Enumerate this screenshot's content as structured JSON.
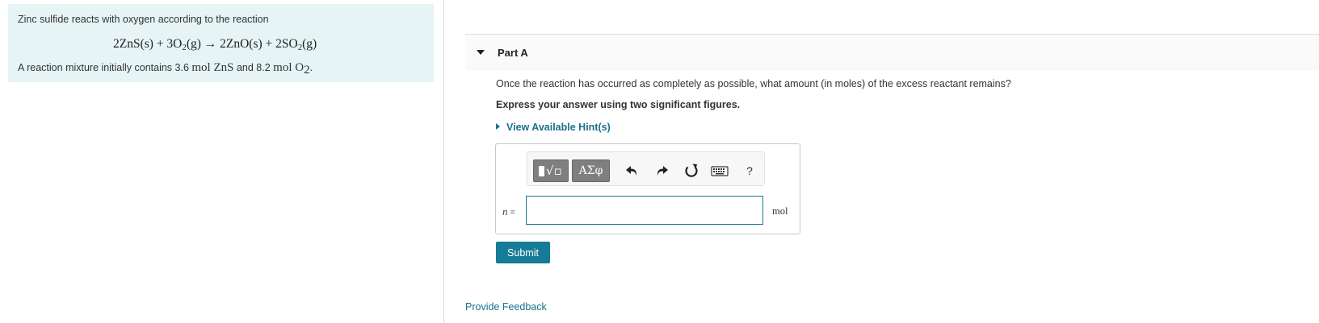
{
  "intro": {
    "statement": "Zinc sulfide reacts with oxygen according to the reaction",
    "equation": {
      "t1": "2ZnS(s) + 3O",
      "s1": "2",
      "t2": "(g) → 2ZnO(s) + 2SO",
      "s2": "2",
      "t3": "(g)"
    },
    "mixture": {
      "pre": "A reaction mixture initially contains ",
      "zns_amount": "3.6 ",
      "zns_unit": "mol ZnS",
      "mid": " and ",
      "o2_amount": "8.2 ",
      "o2_unit": "mol O",
      "o2_sub": "2",
      "end": "."
    }
  },
  "part": {
    "title": "Part A",
    "question": "Once the reaction has occurred as completely as possible, what amount (in moles) of the excess reactant remains?",
    "instruction": "Express your answer using two significant figures.",
    "hint_link": "View Available Hint(s)",
    "answer": {
      "variable": "n",
      "equals": " =",
      "value": "",
      "unit": "mol"
    },
    "toolbar": {
      "templates_icon": "radical-template-icon",
      "symbols_label": "ΑΣφ",
      "undo_icon": "undo-icon",
      "redo_icon": "redo-icon",
      "reset_icon": "reset-icon",
      "keyboard_icon": "keyboard-icon",
      "help_label": "?"
    },
    "submit_label": "Submit"
  },
  "feedback_link": "Provide Feedback",
  "colors": {
    "intro_bg": "#e6f4f5",
    "link": "#1a6f8f",
    "submit_bg": "#167b96",
    "input_border": "#1a7a96"
  }
}
